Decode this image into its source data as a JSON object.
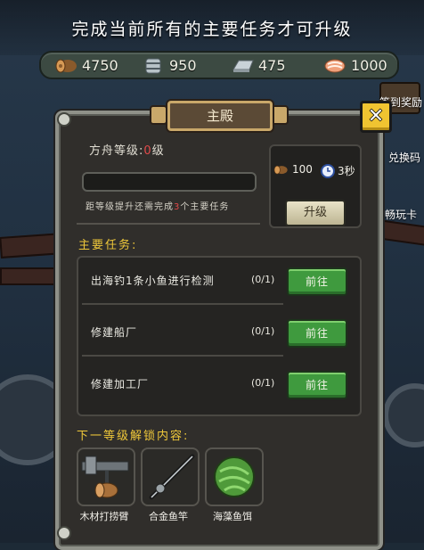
{
  "banner": {
    "text": "完成当前所有的主要任务才可升级"
  },
  "resources": [
    {
      "icon": "wood-log-icon",
      "value": "4750"
    },
    {
      "icon": "wood-bucket-icon",
      "value": "950"
    },
    {
      "icon": "iron-ingot-icon",
      "value": "475"
    },
    {
      "icon": "fish-meat-icon",
      "value": "1000"
    }
  ],
  "side": {
    "sign_reward": "签到奖励",
    "redeem_code": "兑换码",
    "play_card": "畅玩卡"
  },
  "panel": {
    "title": "主殿",
    "level_prefix": "方舟等级:",
    "level_value": "0",
    "level_suffix": "级",
    "hint_prefix": "距等级提升还需完成",
    "hint_count": "3",
    "hint_suffix": "个主要任务",
    "cost": {
      "wood": "100",
      "time": "3秒"
    },
    "upgrade_label": "升级",
    "tasks_title": "主要任务:",
    "tasks": [
      {
        "name": "出海钓1条小鱼进行检测",
        "progress": "(0/1)",
        "button": "前往"
      },
      {
        "name": "修建船厂",
        "progress": "(0/1)",
        "button": "前往"
      },
      {
        "name": "修建加工厂",
        "progress": "(0/1)",
        "button": "前往"
      }
    ],
    "unlock_title": "下一等级解锁内容:",
    "unlocks": [
      {
        "icon": "wood-crane-arm-icon",
        "label": "木材打捞臂"
      },
      {
        "icon": "fishing-rod-icon",
        "label": "合金鱼竿"
      },
      {
        "icon": "seaweed-bait-icon",
        "label": "海藻鱼饵"
      }
    ]
  },
  "colors": {
    "accent_gold": "#efc83a",
    "go_green": "#3f9a3e",
    "warning_red": "#e14a4a"
  }
}
